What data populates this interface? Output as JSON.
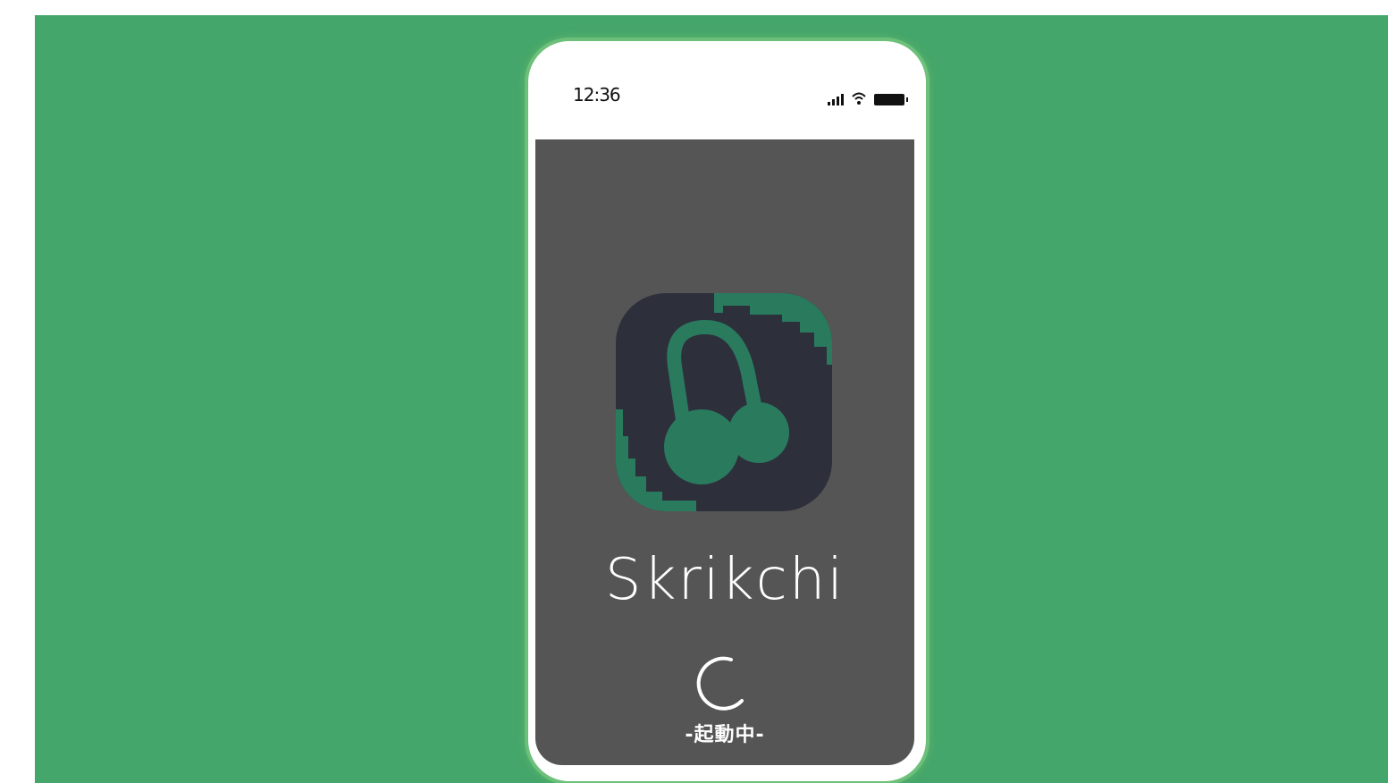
{
  "status_bar": {
    "time": "12:36"
  },
  "splash": {
    "app_name": "Skrikchi",
    "loading_label": "-起動中-"
  },
  "icons": {
    "logo": "headphones-icon",
    "signal": "cellular-signal-icon",
    "wifi": "wifi-icon",
    "battery": "battery-icon",
    "spinner": "loading-spinner-icon"
  },
  "colors": {
    "background": "#45a66b",
    "phone_frame": "#ffffff",
    "screen": "#555555",
    "icon_tile": "#2d2f3b",
    "icon_accent": "#2a7a5e",
    "text": "#ffffff"
  }
}
